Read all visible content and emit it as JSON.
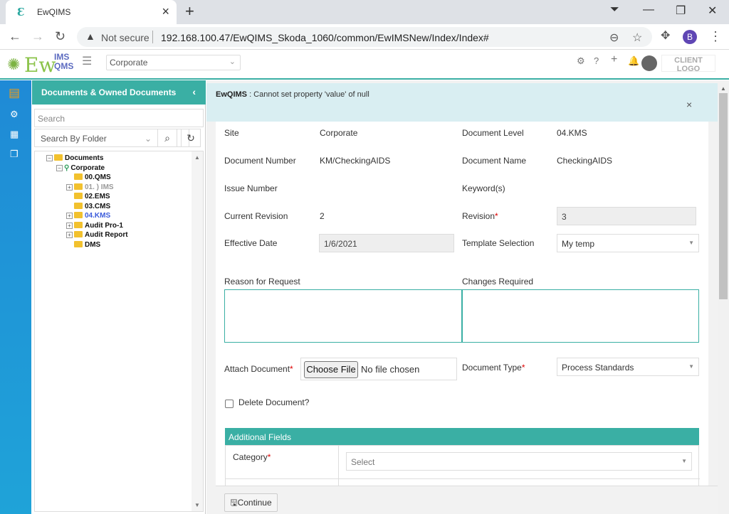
{
  "browser": {
    "tab_title": "EwQIMS",
    "not_secure": "Not secure",
    "url": "192.168.100.47/EwQIMS_Skoda_1060/common/EwIMSNew/Index/Index#",
    "profile_initial": "B"
  },
  "header": {
    "logo_ew": "Ew",
    "logo_ims": "IMS",
    "logo_qms": "QMS",
    "site": "Corporate",
    "client_logo": "CLIENT LOGO"
  },
  "tree": {
    "title": "Documents & Owned Documents",
    "search_placeholder": "Search",
    "folder_select": "Search By Folder",
    "nodes": {
      "root": "Documents",
      "corporate": "Corporate",
      "n1": "00.QMS",
      "n2": "01. ) IMS",
      "n3": "02.EMS",
      "n4": "03.CMS",
      "n5": "04.KMS",
      "n6": "Audit Pro-1",
      "n7": "Audit Report",
      "n8": "DMS"
    }
  },
  "alert": {
    "app": "EwQIMS",
    "message": " : Cannot set property 'value' of null"
  },
  "form": {
    "site_label": "Site",
    "site_value": "Corporate",
    "doc_level_label": "Document Level",
    "doc_level_value": "04.KMS",
    "doc_number_label": "Document Number",
    "doc_number_value": "KM/CheckingAIDS",
    "doc_name_label": "Document Name",
    "doc_name_value": "CheckingAIDS",
    "issue_number_label": "Issue Number",
    "keywords_label": "Keyword(s)",
    "current_rev_label": "Current Revision",
    "current_rev_value": "2",
    "revision_label": "Revision",
    "revision_value": "3",
    "effective_date_label": "Effective Date",
    "effective_date_value": "1/6/2021",
    "template_label": "Template Selection",
    "template_value": "My temp",
    "reason_label": "Reason for Request",
    "changes_label": "Changes Required",
    "attach_label": "Attach Document",
    "choose_file": "Choose File",
    "no_file": "No file chosen",
    "doc_type_label": "Document Type",
    "doc_type_value": "Process Standards",
    "delete_label": "Delete Document?",
    "additional_fields": "Additional Fields",
    "category_label": "Category",
    "category_value": "Select",
    "required_mark": "*",
    "continue": "Continue"
  }
}
